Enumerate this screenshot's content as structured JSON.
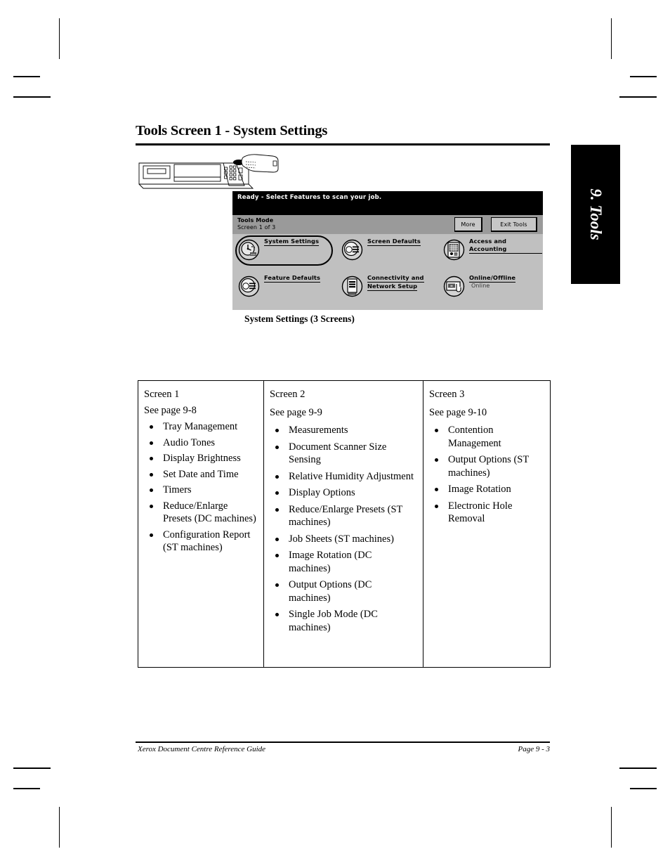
{
  "page": {
    "title": "Tools Screen 1 - System Settings",
    "caption": "System Settings (3 Screens)",
    "side_tab": "9. Tools",
    "illustration_name": "copier-control-panel-line-art"
  },
  "device_ui": {
    "status_bar": "Ready -  Select Features to scan your job.",
    "mode_title": "Tools Mode",
    "mode_subtitle_prefix": "Screen ",
    "mode_subtitle_number": "1",
    "mode_subtitle_suffix": " of 3",
    "mode_subtitle_full": "Screen 1 of 3",
    "buttons": {
      "more": "More",
      "exit_tools": "Exit Tools"
    },
    "features": [
      {
        "label": "System Settings",
        "label_line2": "",
        "status": "",
        "icon": "clock-icon",
        "selected": true
      },
      {
        "label": "Screen Defaults",
        "label_line2": "",
        "status": "",
        "icon": "screen-list-icon",
        "selected": false
      },
      {
        "label": "Access and Accounting",
        "label_line2": "",
        "status": "",
        "icon": "keypad-grid-icon",
        "selected": false
      },
      {
        "label": "Feature Defaults",
        "label_line2": "",
        "status": "",
        "icon": "screen-list-icon",
        "selected": false
      },
      {
        "label": "Connectivity and",
        "label_line2": "Network Setup",
        "status": "",
        "icon": "network-server-icon",
        "selected": false
      },
      {
        "label": "Online/Offline",
        "label_line2": "",
        "status": "Online",
        "icon": "online-hand-icon",
        "selected": false
      }
    ]
  },
  "table": {
    "columns": [
      {
        "header": "Screen 1",
        "see_page": "See page 9-8",
        "items": [
          "Tray Management",
          "Audio Tones",
          "Display Brightness",
          "Set Date and Time",
          "Timers",
          "Reduce/Enlarge Presets (DC machines)",
          "Configuration Report (ST machines)"
        ]
      },
      {
        "header": "Screen 2",
        "see_page": "See page 9-9",
        "items": [
          "Measurements",
          "Document Scanner Size Sensing",
          "Relative Humidity Adjustment",
          "Display Options",
          "Reduce/Enlarge Presets (ST machines)",
          "Job Sheets (ST machines)",
          "Image Rotation (DC machines)",
          "Output Options (DC machines)",
          "Single Job Mode (DC machines)"
        ]
      },
      {
        "header": "Screen 3",
        "see_page": "See page 9-10",
        "items": [
          "Contention Management",
          "Output Options (ST machines)",
          "Image Rotation",
          "Electronic Hole Removal"
        ]
      }
    ]
  },
  "footer": {
    "left": "Xerox Document Centre Reference Guide",
    "right": "Page 9 - 3"
  }
}
